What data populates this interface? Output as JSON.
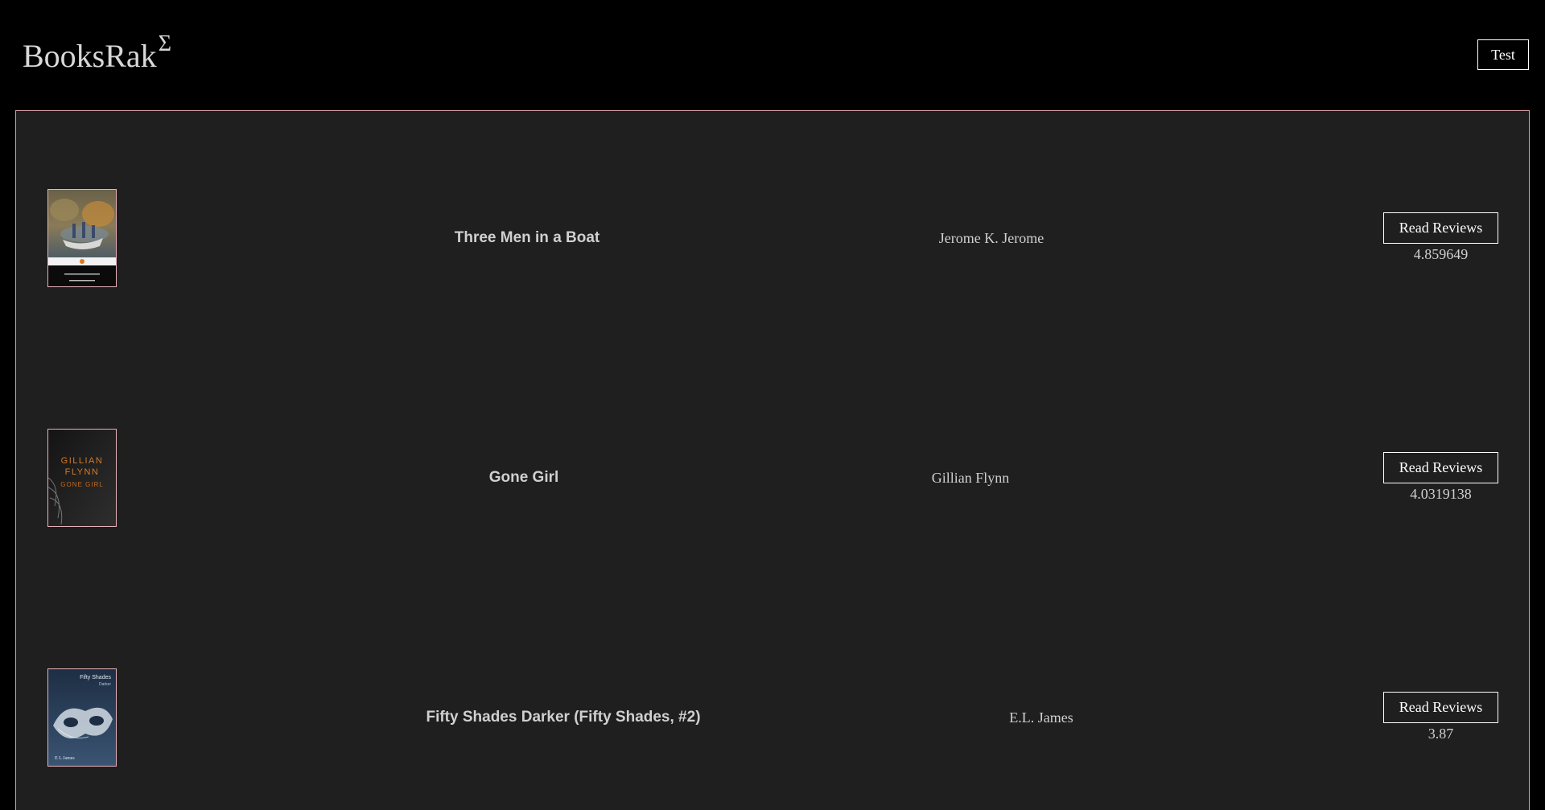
{
  "header": {
    "brand": "BooksRak",
    "brand_sup": "Σ",
    "test_button": "Test"
  },
  "colors": {
    "background": "#000000",
    "panel": "#1f1f1f",
    "panel_border": "#d49ea6",
    "text": "#d0d0d0"
  },
  "books": [
    {
      "title": "Three Men in a Boat",
      "author": "Jerome K. Jerome",
      "button": "Read Reviews",
      "rating": "4.859649",
      "cover_icon": "book-cover-image"
    },
    {
      "title": "Gone Girl",
      "author": "Gillian Flynn",
      "button": "Read Reviews",
      "rating": "4.0319138",
      "cover_icon": "book-cover-image",
      "cover_text": [
        "GILLIAN",
        "FLYNN",
        "GONE GIRL"
      ]
    },
    {
      "title": "Fifty Shades Darker (Fifty Shades, #2)",
      "author": "E.L. James",
      "button": "Read Reviews",
      "rating": "3.87",
      "cover_icon": "book-cover-image",
      "cover_text": [
        "Fifty Shades",
        "Darker",
        "E L James"
      ]
    }
  ]
}
